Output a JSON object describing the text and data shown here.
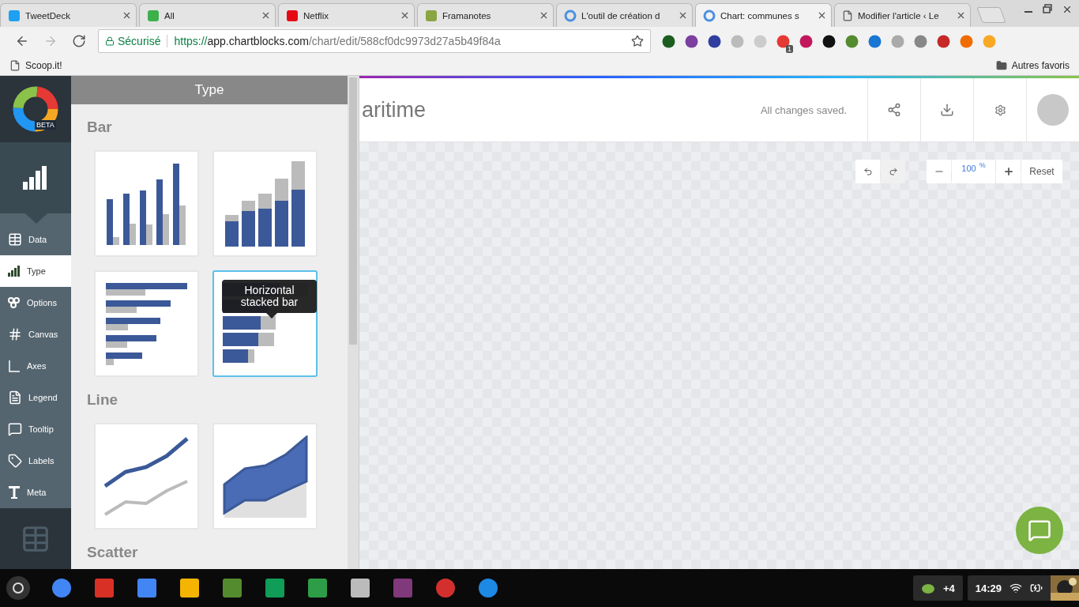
{
  "browser": {
    "tabs": [
      {
        "title": "TweetDeck",
        "selected": false
      },
      {
        "title": "All",
        "selected": false
      },
      {
        "title": "Netflix",
        "selected": false
      },
      {
        "title": "Framanotes",
        "selected": false
      },
      {
        "title": "L'outil de création d",
        "selected": false
      },
      {
        "title": "Chart: communes s",
        "selected": true
      },
      {
        "title": "Modifier l'article ‹ Le",
        "selected": false
      }
    ],
    "security_label": "Sécurisé",
    "url": {
      "scheme": "https://",
      "host": "app.chartblocks.com",
      "path": "/chart/edit/588cf0dc9973d27a5b49f84a"
    },
    "extension_badge": "1",
    "bookmarks": [
      {
        "label": "Scoop.it!",
        "kind": "page"
      },
      {
        "label": "Autres favoris",
        "kind": "folder"
      }
    ]
  },
  "app": {
    "logo_badge": "BETA",
    "nav": [
      {
        "label": "Data",
        "selected": false
      },
      {
        "label": "Type",
        "selected": true
      },
      {
        "label": "Options",
        "selected": false
      },
      {
        "label": "Canvas",
        "selected": false
      },
      {
        "label": "Axes",
        "selected": false
      },
      {
        "label": "Legend",
        "selected": false
      },
      {
        "label": "Tooltip",
        "selected": false
      },
      {
        "label": "Labels",
        "selected": false
      },
      {
        "label": "Meta",
        "selected": false
      }
    ],
    "panel": {
      "title": "Type",
      "sections": [
        {
          "heading": "Bar",
          "cards": [
            {
              "kind": "bar",
              "selected": false
            },
            {
              "kind": "stacked-bar",
              "selected": false
            },
            {
              "kind": "horizontal-bar",
              "selected": false
            },
            {
              "kind": "horizontal-stacked-bar",
              "selected": true,
              "tooltip": "Horizontal stacked bar"
            }
          ]
        },
        {
          "heading": "Line",
          "cards": [
            {
              "kind": "line",
              "selected": false
            },
            {
              "kind": "area",
              "selected": false
            }
          ]
        },
        {
          "heading": "Scatter"
        }
      ]
    },
    "chart_title": "aritime",
    "save_status": "All changes saved.",
    "zoom": {
      "value": "100",
      "unit": "%",
      "reset": "Reset"
    }
  },
  "taskbar": {
    "tray_count": "+4",
    "time": "14:29"
  }
}
